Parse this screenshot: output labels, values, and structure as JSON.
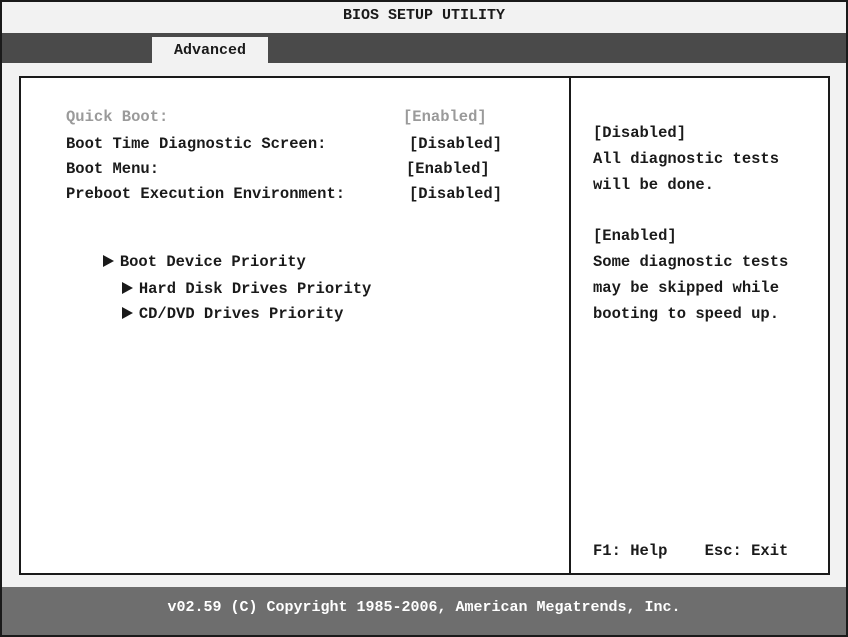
{
  "header": {
    "title": "BIOS SETUP UTILITY"
  },
  "tabs": [
    {
      "label": "Advanced",
      "active": true
    }
  ],
  "settings": [
    {
      "label": "Quick Boot:",
      "value": "[Enabled]",
      "grayed": true
    },
    {
      "label": "Boot Time Diagnostic Screen:",
      "value": "[Disabled]",
      "grayed": false
    },
    {
      "label": "Boot Menu:",
      "value": "[Enabled]",
      "grayed": false
    },
    {
      "label": "Preboot Execution Environment:",
      "value": "[Disabled]",
      "grayed": false
    }
  ],
  "submenus": [
    {
      "label": "Boot Device Priority"
    },
    {
      "label": "Hard Disk Drives Priority"
    },
    {
      "label": "CD/DVD Drives Priority"
    }
  ],
  "help": {
    "lines": [
      "[Disabled]",
      "All diagnostic tests",
      "will be done.",
      "",
      "[Enabled]",
      "Some diagnostic tests",
      "may be skipped while",
      "booting to speed up."
    ],
    "keys": "F1: Help    Esc: Exit"
  },
  "footer": {
    "copyright": "v02.59 (C) Copyright 1985-2006, American Megatrends, Inc."
  },
  "colors": {
    "frame": "#1a1a1a",
    "tab_strip": "#4a4a4a",
    "status_bar": "#6e6e6e",
    "grayed_text": "#9a9a9a"
  }
}
